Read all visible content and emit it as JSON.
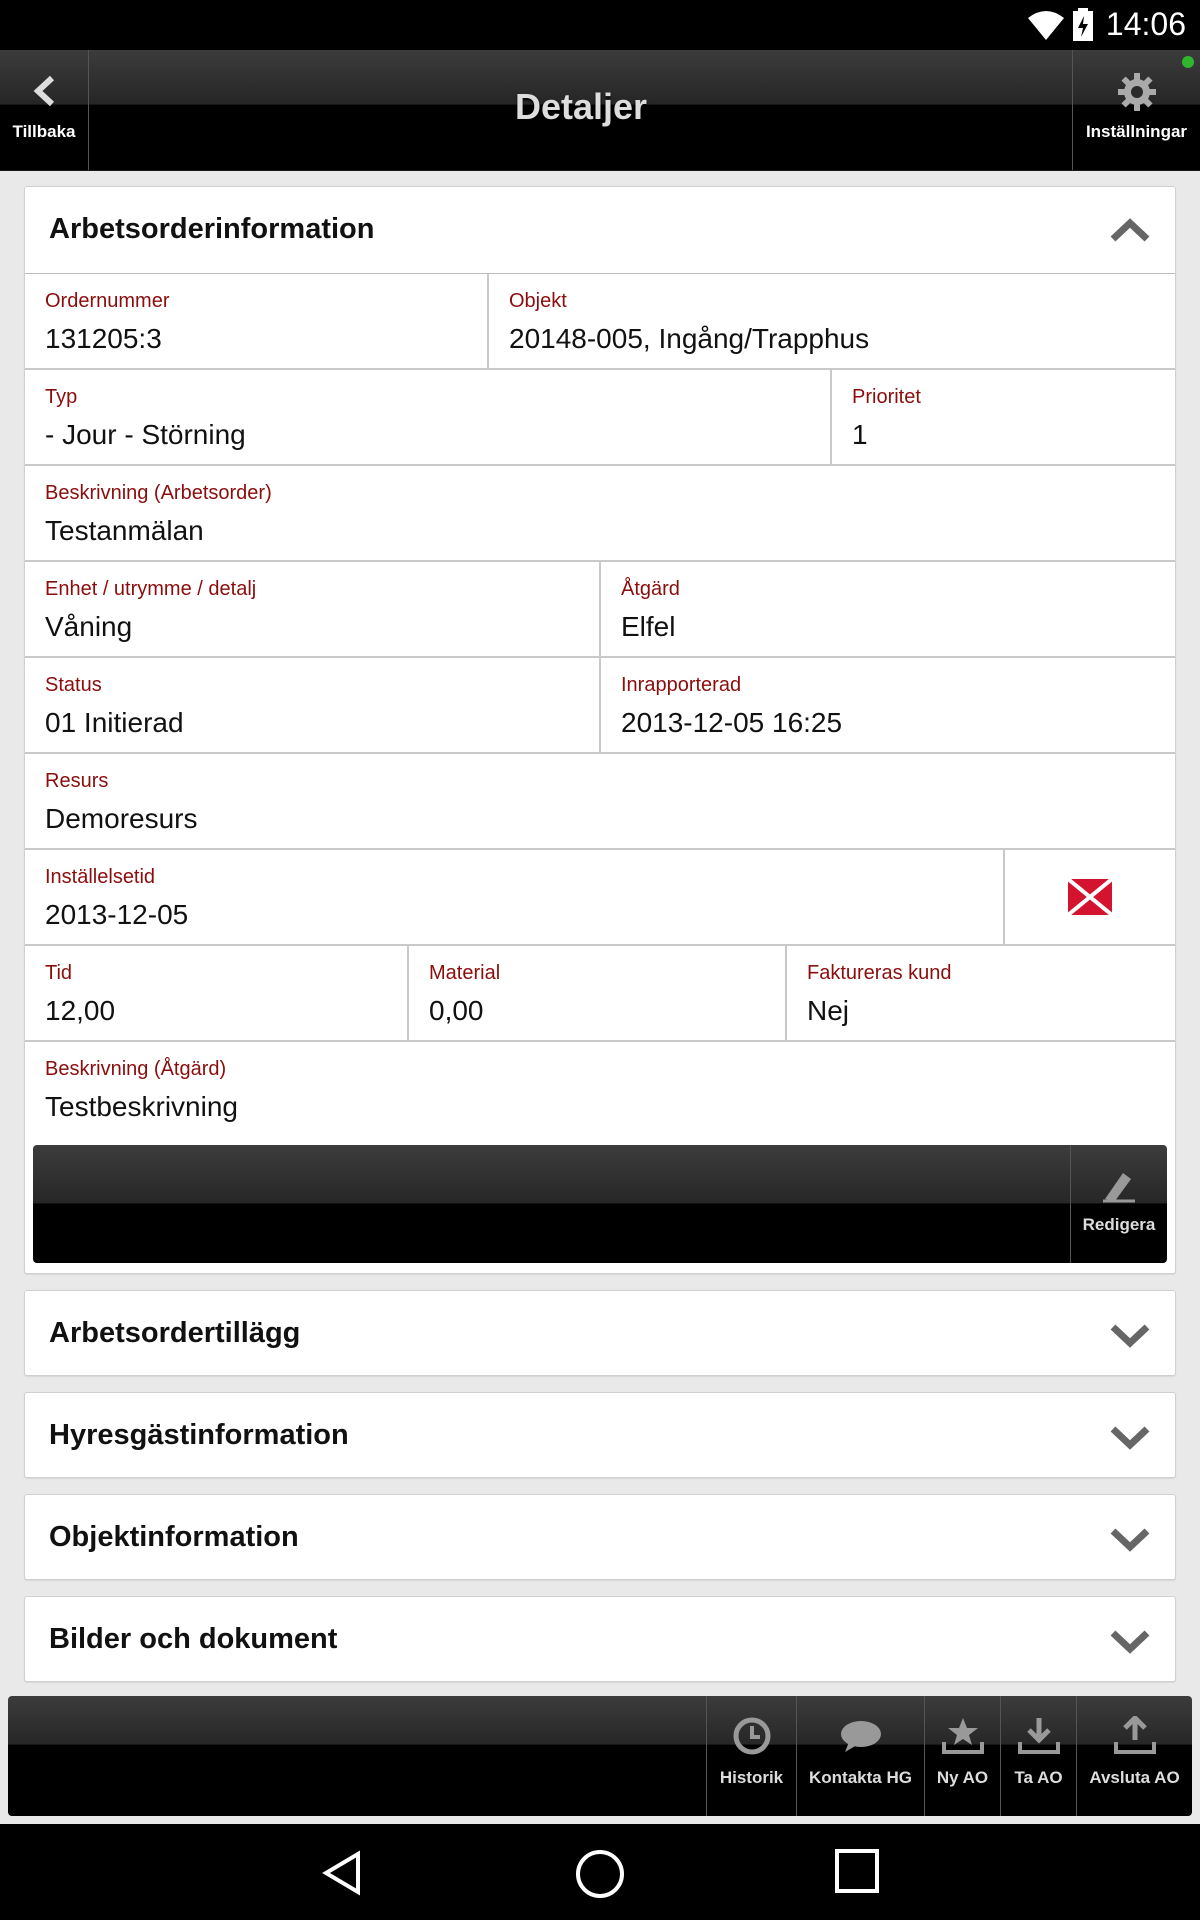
{
  "status_bar": {
    "time": "14:06"
  },
  "header": {
    "title": "Detaljer",
    "back_label": "Tillbaka",
    "settings_label": "Inställningar"
  },
  "work_order": {
    "title": "Arbetsorderinformation",
    "fields": {
      "ordernummer": {
        "label": "Ordernummer",
        "value": "131205:3"
      },
      "objekt": {
        "label": "Objekt",
        "value": "20148-005, Ingång/Trapphus"
      },
      "typ": {
        "label": "Typ",
        "value": "- Jour - Störning"
      },
      "prioritet": {
        "label": "Prioritet",
        "value": "1"
      },
      "beskrivning_ao": {
        "label": "Beskrivning (Arbetsorder)",
        "value": "Testanmälan"
      },
      "enhet": {
        "label": "Enhet / utrymme / detalj",
        "value": "Våning"
      },
      "atgard": {
        "label": "Åtgärd",
        "value": "Elfel"
      },
      "status": {
        "label": "Status",
        "value": "01 Initierad"
      },
      "inrapporterad": {
        "label": "Inrapporterad",
        "value": "2013-12-05 16:25"
      },
      "resurs": {
        "label": "Resurs",
        "value": "Demoresurs"
      },
      "installelsetid": {
        "label": "Inställelsetid",
        "value": "2013-12-05"
      },
      "tid": {
        "label": "Tid",
        "value": "12,00"
      },
      "material": {
        "label": "Material",
        "value": "0,00"
      },
      "faktureras": {
        "label": "Faktureras kund",
        "value": "Nej"
      },
      "beskrivning_atgard": {
        "label": "Beskrivning (Åtgärd)",
        "value": "Testbeskrivning"
      }
    },
    "edit_label": "Redigera"
  },
  "sections": [
    {
      "title": "Arbetsordertillägg"
    },
    {
      "title": "Hyresgästinformation"
    },
    {
      "title": "Objektinformation"
    },
    {
      "title": "Bilder och dokument"
    }
  ],
  "toolbar": {
    "historik": "Historik",
    "kontakta": "Kontakta HG",
    "ny_ao": "Ny AO",
    "ta_ao": "Ta AO",
    "avsluta_ao": "Avsluta AO"
  },
  "colors": {
    "label_red": "#8b0d0d",
    "online_green": "#2fb52f",
    "delete_red": "#d4142e"
  }
}
